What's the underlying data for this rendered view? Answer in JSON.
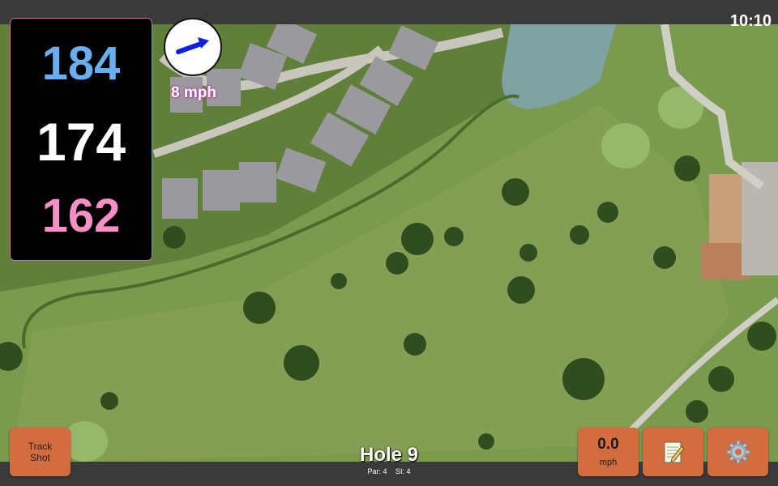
{
  "clock": "10:10",
  "distances": {
    "back": "184",
    "center": "174",
    "front": "162"
  },
  "wind": {
    "speed_label": "8 mph",
    "direction_icon": "wind-arrow-icon"
  },
  "buttons": {
    "track_shot": "Track\nShot",
    "wind_value": "0.0",
    "wind_unit": "mph",
    "notes_icon": "notepad-icon",
    "settings_icon": "gear-icon"
  },
  "hole": {
    "title": "Hole 9",
    "par": "Par: 4",
    "si": "SI: 4"
  },
  "colors": {
    "back": "#6aaef2",
    "center": "#ffffff",
    "front": "#f58fc6",
    "button": "#d36d3f",
    "accent": "#b14fa0"
  }
}
